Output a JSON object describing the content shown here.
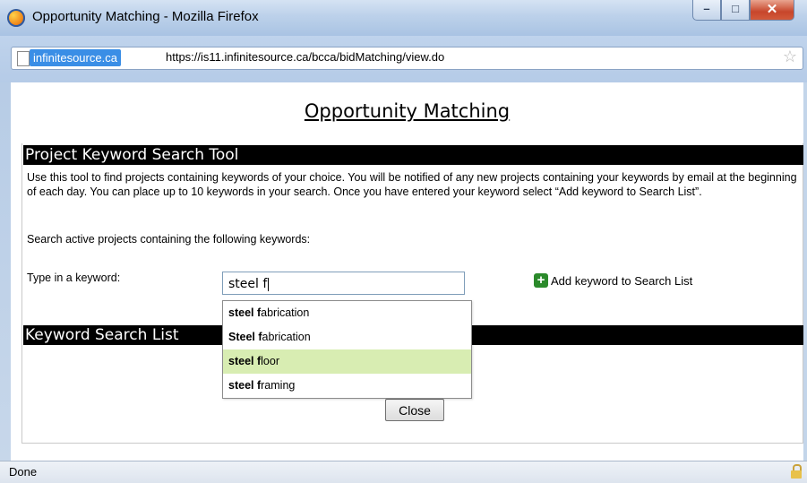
{
  "window": {
    "title": "Opportunity Matching - Mozilla Firefox",
    "controls": {
      "minimize": "–",
      "maximize": "□",
      "close": "✕"
    }
  },
  "address_bar": {
    "site_identity": "infinitesource.ca",
    "url": "https://is11.infinitesource.ca/bcca/bidMatching/view.do"
  },
  "page": {
    "title": "Opportunity Matching",
    "section1_header": "Project Keyword Search Tool",
    "description": "Use this tool to find projects containing keywords of your choice. You will be notified of any new projects containing your keywords by email at the beginning of each day. You can place up to 10 keywords in your search. Once you have entered your keyword select “Add keyword to Search List”.",
    "search_label": "Search active projects containing the following keywords:",
    "keyword_label": "Type in a keyword:",
    "keyword_value": "steel f",
    "add_button_label": "Add keyword to Search List",
    "section2_header": "Keyword Search List",
    "close_button_label": "Close"
  },
  "autocomplete": {
    "highlighted_index": 2,
    "items": [
      {
        "bold": "steel f",
        "rest": "abrication"
      },
      {
        "bold": "Steel f",
        "rest": "abrication"
      },
      {
        "bold": "steel f",
        "rest": "loor"
      },
      {
        "bold": "steel f",
        "rest": "raming"
      }
    ]
  },
  "status_bar": {
    "text": "Done"
  },
  "colors": {
    "highlight": "#d8edb2",
    "section_bar": "#000000",
    "add_icon": "#2b8a2b"
  },
  "icons": [
    "firefox-icon",
    "page-icon",
    "star-icon",
    "plus-icon",
    "lock-icon"
  ]
}
